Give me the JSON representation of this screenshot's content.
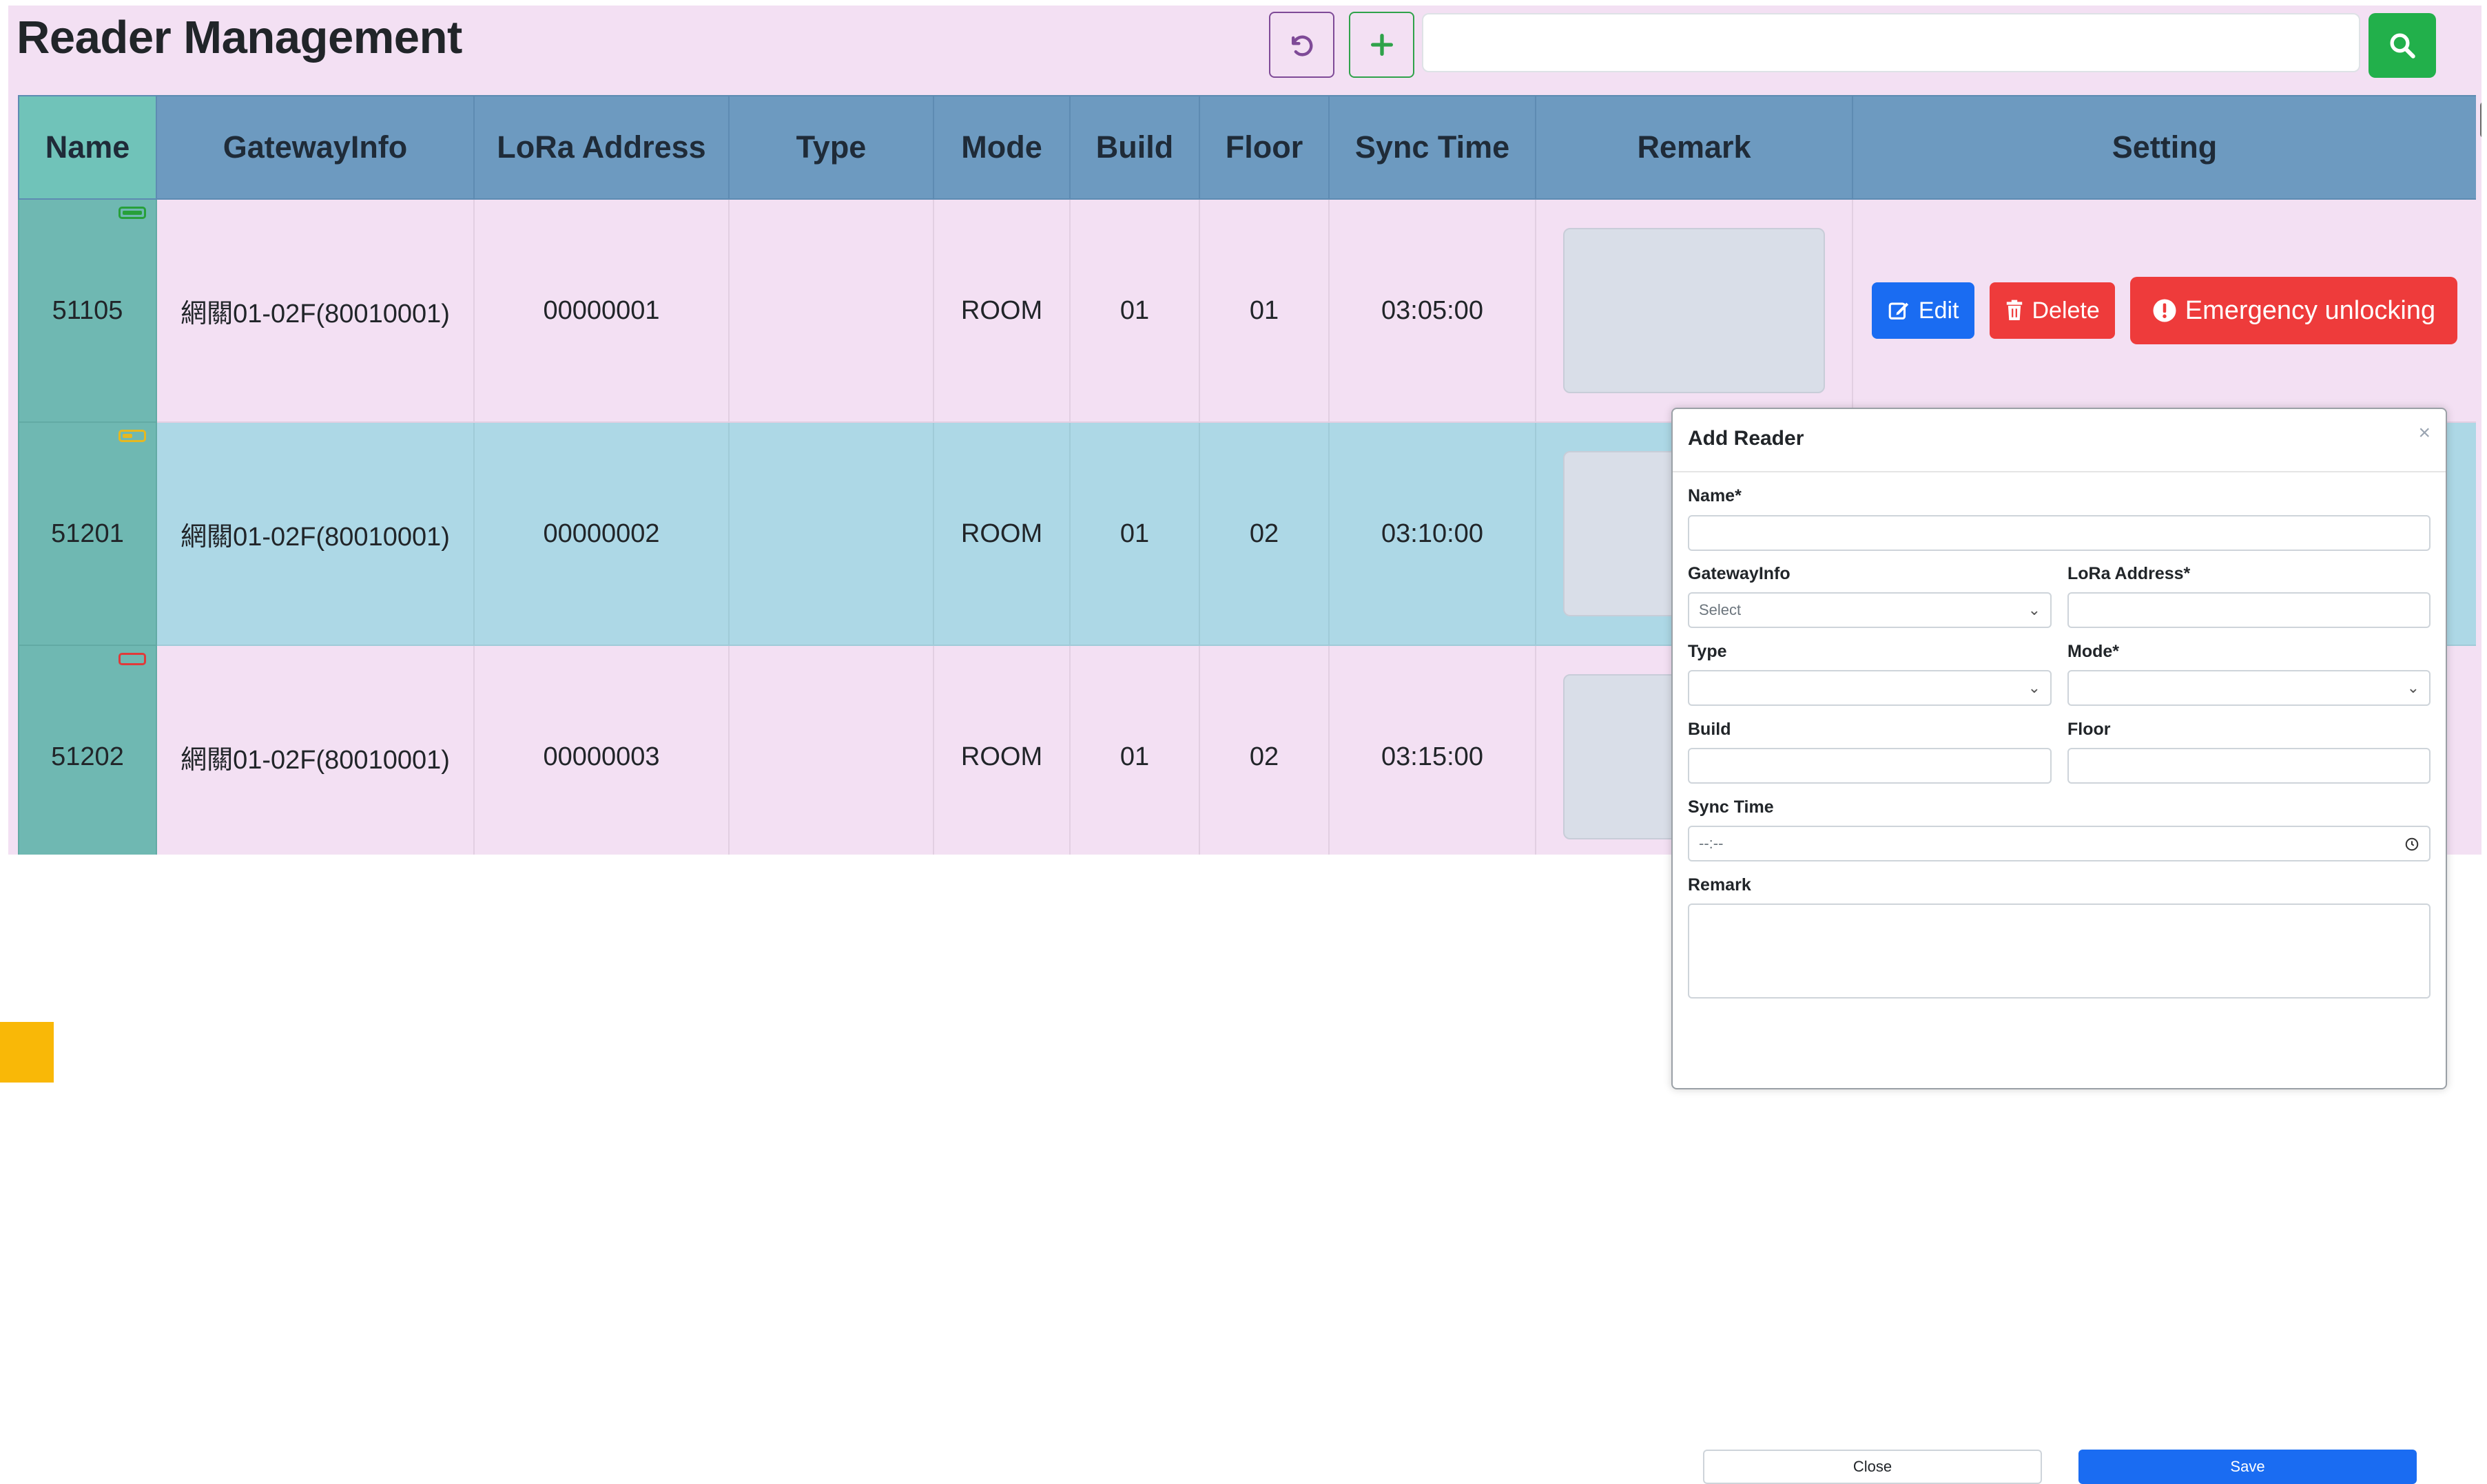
{
  "page": {
    "title": "Reader Management"
  },
  "toolbar": {
    "refresh_icon": "refresh-icon",
    "add_icon": "plus-icon",
    "search_value": "",
    "search_icon": "search-icon"
  },
  "table": {
    "headers": [
      "Name",
      "GatewayInfo",
      "LoRa Address",
      "Type",
      "Mode",
      "Build",
      "Floor",
      "Sync Time",
      "Remark",
      "Setting"
    ],
    "rows": [
      {
        "name": "51105",
        "gateway": "網關01-02F(80010001)",
        "lora": "00000001",
        "type": "",
        "mode": "ROOM",
        "build": "01",
        "floor": "01",
        "sync": "03:05:00",
        "battery": "full",
        "battery_color": "#27a03a"
      },
      {
        "name": "51201",
        "gateway": "網關01-02F(80010001)",
        "lora": "00000002",
        "type": "",
        "mode": "ROOM",
        "build": "01",
        "floor": "02",
        "sync": "03:10:00",
        "battery": "half",
        "battery_color": "#e6b820"
      },
      {
        "name": "51202",
        "gateway": "網關01-02F(80010001)",
        "lora": "00000003",
        "type": "",
        "mode": "ROOM",
        "build": "01",
        "floor": "02",
        "sync": "03:15:00",
        "battery": "empty",
        "battery_color": "#e03a3a"
      }
    ],
    "actions": {
      "edit": "Edit",
      "delete": "Delete",
      "emergency": "Emergency unlocking"
    }
  },
  "modal": {
    "title": "Add Reader",
    "close_glyph": "×",
    "labels": {
      "name": "Name*",
      "gateway": "GatewayInfo",
      "lora": "LoRa Address*",
      "type": "Type",
      "mode": "Mode*",
      "build": "Build",
      "floor": "Floor",
      "sync": "Sync Time",
      "remark": "Remark"
    },
    "gateway_placeholder": "Select",
    "sync_placeholder": "--:--",
    "close_button": "Close",
    "save_button": "Save"
  },
  "colors": {
    "page_bg": "#f3e0f3",
    "header_bg": "#6d9ac0",
    "name_col_bg": "#70c3b9",
    "highlight_row": "#add8e6",
    "search_green": "#22b04b",
    "edit_blue": "#1a6cf2",
    "danger_red": "#ee3b3b",
    "save_blue": "#1a6cf2"
  }
}
